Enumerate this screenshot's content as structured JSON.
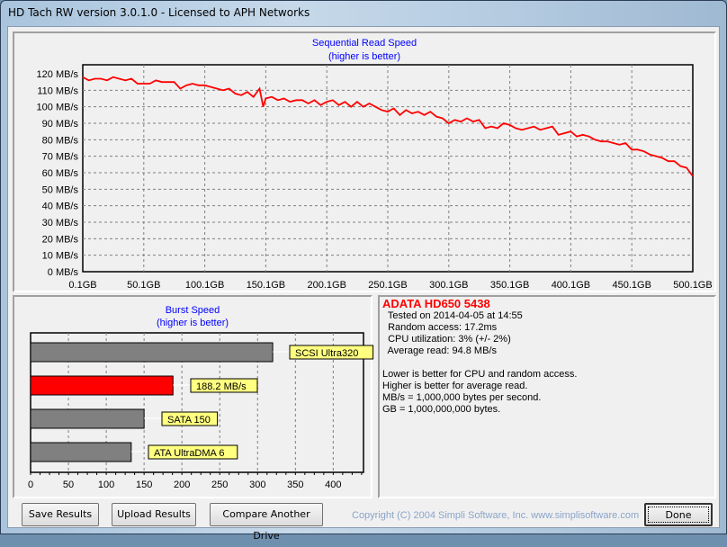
{
  "window": {
    "title": "HD Tach RW version 3.0.1.0 - Licensed to APH Networks"
  },
  "seq_chart": {
    "title": "Sequential Read Speed",
    "subtitle": "(higher is better)"
  },
  "burst_chart": {
    "title": "Burst Speed",
    "subtitle": "(higher is better)"
  },
  "chart_data": [
    {
      "type": "line",
      "title": "Sequential Read Speed (higher is better)",
      "ylim": [
        0,
        120
      ],
      "xlim": [
        0.1,
        500.1
      ],
      "grid": true,
      "ytick_labels": [
        "0 MB/s",
        "10 MB/s",
        "20 MB/s",
        "30 MB/s",
        "40 MB/s",
        "50 MB/s",
        "60 MB/s",
        "70 MB/s",
        "80 MB/s",
        "90 MB/s",
        "100 MB/s",
        "110 MB/s",
        "120 MB/s"
      ],
      "xtick_labels": [
        "0.1GB",
        "50.1GB",
        "100.1GB",
        "150.1GB",
        "200.1GB",
        "250.1GB",
        "300.1GB",
        "350.1GB",
        "400.1GB",
        "450.1GB",
        "500.1GB"
      ],
      "series": [
        {
          "color": "#ff0000",
          "x": [
            0,
            5,
            10,
            15,
            20,
            25,
            30,
            35,
            40,
            45,
            50,
            55,
            60,
            65,
            70,
            75,
            80,
            85,
            90,
            95,
            100,
            105,
            110,
            115,
            120,
            125,
            130,
            135,
            140,
            145,
            148,
            150,
            155,
            160,
            165,
            170,
            175,
            180,
            185,
            190,
            195,
            200,
            205,
            210,
            215,
            220,
            225,
            230,
            235,
            240,
            245,
            250,
            255,
            260,
            265,
            270,
            275,
            280,
            285,
            290,
            295,
            300,
            305,
            310,
            315,
            320,
            325,
            330,
            335,
            340,
            345,
            350,
            355,
            360,
            365,
            370,
            375,
            380,
            385,
            390,
            395,
            400,
            405,
            410,
            415,
            420,
            425,
            430,
            435,
            440,
            445,
            450,
            455,
            460,
            465,
            470,
            475,
            480,
            485,
            490,
            495,
            500
          ],
          "y": [
            118,
            116,
            117,
            117,
            116,
            118,
            117,
            116,
            117,
            114,
            114,
            114,
            116,
            115,
            115,
            115,
            111,
            113,
            114,
            113,
            113,
            112,
            111,
            110,
            111,
            108,
            107,
            109,
            106,
            111,
            100,
            105,
            106,
            104,
            105,
            103,
            104,
            104,
            102,
            104,
            101,
            103,
            104,
            101,
            103,
            100,
            103,
            100,
            102,
            100,
            98,
            97,
            99,
            95,
            98,
            96,
            97,
            95,
            97,
            94,
            93,
            90,
            92,
            91,
            93,
            91,
            92,
            87,
            88,
            87,
            90,
            89,
            87,
            86,
            87,
            88,
            86,
            87,
            88,
            83,
            84,
            85,
            82,
            83,
            82,
            80,
            79,
            79,
            78,
            77,
            78,
            74,
            74,
            73,
            71,
            70,
            69,
            67,
            67,
            64,
            63,
            58
          ]
        }
      ]
    },
    {
      "type": "bar",
      "title": "Burst Speed (higher is better)",
      "orientation": "horizontal",
      "xlim": [
        0,
        440
      ],
      "xtick_labels": [
        "0",
        "50",
        "100",
        "150",
        "200",
        "250",
        "300",
        "350",
        "400"
      ],
      "categories": [
        "SCSI Ultra320",
        "188.2 MB/s",
        "SATA 150",
        "ATA UltraDMA 6"
      ],
      "values": [
        320,
        188.2,
        150,
        133
      ],
      "colors": [
        "#808080",
        "#ff0000",
        "#808080",
        "#808080"
      ],
      "label_bg": "#ffff80"
    }
  ],
  "info": {
    "drive": "ADATA HD650 5438",
    "tested": "  Tested on 2014-04-05 at 14:55",
    "random": "  Random access: 17.2ms",
    "cpu": "  CPU utilization: 3% (+/- 2%)",
    "avg": "  Average read: 94.8 MB/s",
    "note1": "Lower is better for CPU and random access.",
    "note2": "Higher is better for average read.",
    "note3": "MB/s = 1,000,000 bytes per second.",
    "note4": "GB = 1,000,000,000 bytes."
  },
  "buttons": {
    "save": "Save Results",
    "upload": "Upload Results",
    "compare": "Compare Another Drive",
    "done": "Done"
  },
  "copyright": "Copyright (C) 2004 Simpli Software, Inc. www.simplisoftware.com"
}
